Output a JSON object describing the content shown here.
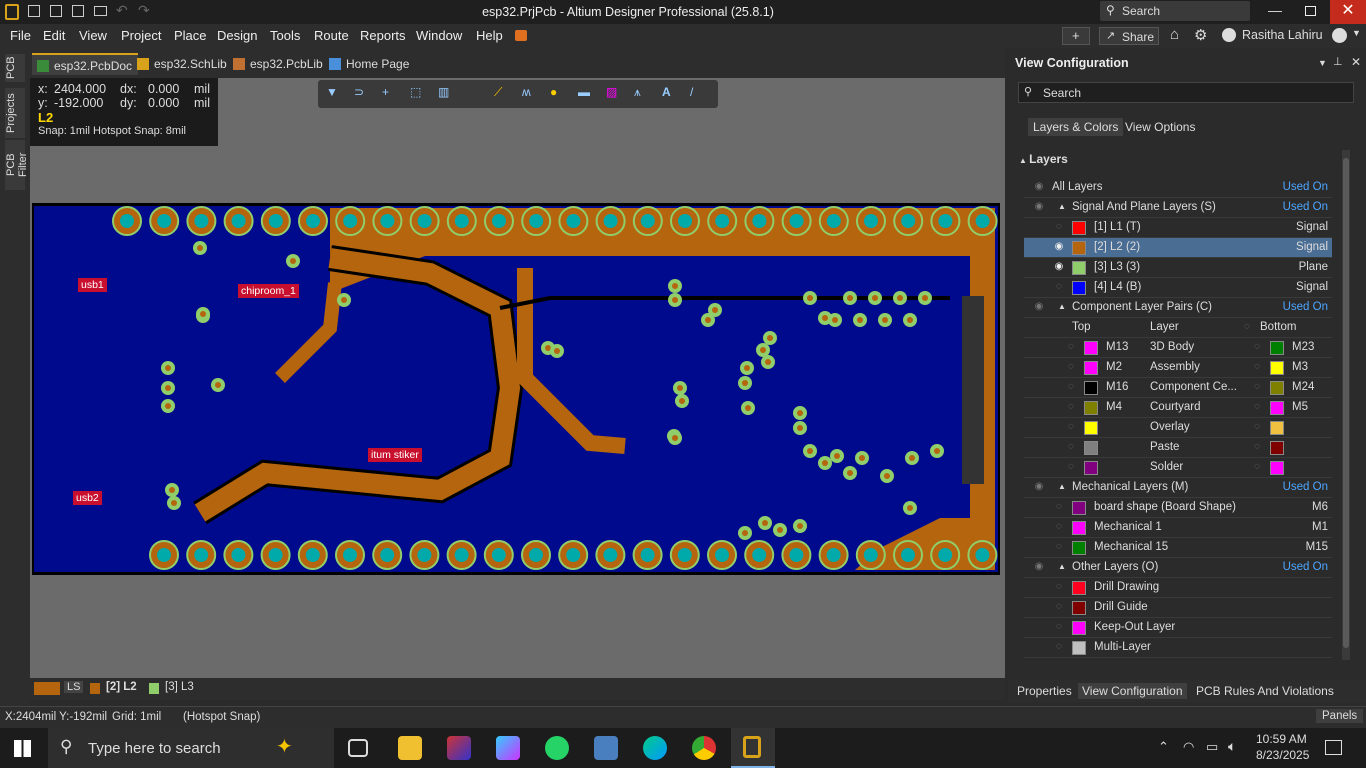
{
  "titlebar": {
    "title": "esp32.PrjPcb - Altium Designer Professional (25.8.1)",
    "search_placeholder": "Search"
  },
  "menu": [
    "File",
    "Edit",
    "View",
    "Project",
    "Place",
    "Design",
    "Tools",
    "Route",
    "Reports",
    "Window",
    "Help"
  ],
  "topright": {
    "share": "Share",
    "user": "Rasitha Lahiru"
  },
  "left_tabs": [
    "PCB",
    "Projects",
    "PCB Filter"
  ],
  "doc_tabs": [
    "esp32.PcbDoc",
    "esp32.SchLib",
    "esp32.PcbLib",
    "Home Page"
  ],
  "coords": {
    "x_label": "x:",
    "x": "2404.000",
    "dx_label": "dx:",
    "dx": "0.000",
    "unit": "mil",
    "y_label": "y:",
    "y": "-192.000",
    "dy_label": "dy:",
    "dy": "0.000",
    "layer": "L2",
    "snap": "Snap: 1mil Hotspot Snap: 8mil"
  },
  "pcb_labels": {
    "usb1": "usb1",
    "chiproom": "chiproom_1",
    "stiker": "itum stiker",
    "usb2": "usb2"
  },
  "panel": {
    "title": "View Configuration",
    "search_placeholder": "Search",
    "tabs": [
      "Layers & Colors",
      "View Options"
    ],
    "section": "Layers",
    "rows": [
      {
        "text": "All Layers",
        "right": "Used On",
        "indent": 1,
        "used": true
      },
      {
        "text": "Signal And Plane Layers (S)",
        "right": "Used On",
        "indent": 2,
        "used": true,
        "group": true
      },
      {
        "text": "[1] L1 (T)",
        "right": "Signal",
        "indent": 3,
        "color": "#ff0000"
      },
      {
        "text": "[2] L2 (2)",
        "right": "Signal",
        "indent": 3,
        "color": "#b5650d",
        "sel": true
      },
      {
        "text": "[3] L3 (3)",
        "right": "Plane",
        "indent": 3,
        "color": "#8fce6b"
      },
      {
        "text": "[4] L4 (B)",
        "right": "Signal",
        "indent": 3,
        "color": "#0000ff"
      },
      {
        "text": "Component Layer Pairs (C)",
        "right": "Used On",
        "indent": 2,
        "used": true,
        "group": true
      },
      {
        "text": "Top",
        "mid": "Layer",
        "right": "Bottom",
        "header": true
      },
      {
        "text": "M13",
        "mid": "3D Body",
        "right": "M23",
        "ct": "#ff00ff",
        "cb": "#008000"
      },
      {
        "text": "M2",
        "mid": "Assembly",
        "right": "M3",
        "ct": "#ff00ff",
        "cb": "#ffff00"
      },
      {
        "text": "M16",
        "mid": "Component Ce...",
        "right": "M24",
        "ct": "#000000",
        "cb": "#808000"
      },
      {
        "text": "M4",
        "mid": "Courtyard",
        "right": "M5",
        "ct": "#808000",
        "cb": "#ff00ff"
      },
      {
        "text": "",
        "mid": "Overlay",
        "right": "",
        "ct": "#ffff00",
        "cb": "#f0c040"
      },
      {
        "text": "",
        "mid": "Paste",
        "right": "",
        "ct": "#808080",
        "cb": "#800000"
      },
      {
        "text": "",
        "mid": "Solder",
        "right": "",
        "ct": "#800080",
        "cb": "#ff00ff"
      },
      {
        "text": "Mechanical Layers (M)",
        "right": "Used On",
        "indent": 2,
        "used": true,
        "group": true
      },
      {
        "text": "board shape (Board Shape)",
        "right": "M6",
        "indent": 3,
        "color": "#800080"
      },
      {
        "text": "Mechanical 1",
        "right": "M1",
        "indent": 3,
        "color": "#ff00ff"
      },
      {
        "text": "Mechanical 15",
        "right": "M15",
        "indent": 3,
        "color": "#008000"
      },
      {
        "text": "Other Layers (O)",
        "right": "Used On",
        "indent": 2,
        "used": true,
        "group": true
      },
      {
        "text": "Drill Drawing",
        "right": "",
        "indent": 3,
        "color": "#ff0020"
      },
      {
        "text": "Drill Guide",
        "right": "",
        "indent": 3,
        "color": "#800000"
      },
      {
        "text": "Keep-Out Layer",
        "right": "",
        "indent": 3,
        "color": "#ff00ff"
      },
      {
        "text": "Multi-Layer",
        "right": "",
        "indent": 3,
        "color": "#c0c0c0"
      }
    ],
    "bottom_tabs": [
      "Properties",
      "View Configuration",
      "PCB Rules And Violations"
    ]
  },
  "layer_tabs": [
    "LS",
    "[2] L2",
    "[3] L3"
  ],
  "status": {
    "pos": "X:2404mil Y:-192mil",
    "grid": "Grid: 1mil",
    "snap": "(Hotspot Snap)",
    "panels": "Panels"
  },
  "taskbar": {
    "search": "Type here to search",
    "time": "10:59 AM",
    "date": "8/23/2025"
  }
}
